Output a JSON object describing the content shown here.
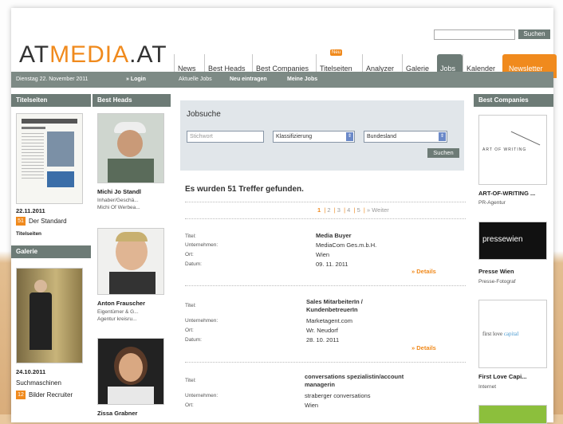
{
  "header": {
    "logo_a": "AT",
    "logo_m": "MEDIA",
    "logo_b": ".AT",
    "search_button": "Suchen"
  },
  "tabs": [
    {
      "label": "News"
    },
    {
      "label": "Best Heads"
    },
    {
      "label": "Best Companies"
    },
    {
      "label": "Titelseiten"
    },
    {
      "label": "Analyzer"
    },
    {
      "label": "Galerie"
    },
    {
      "label": "Jobs"
    },
    {
      "label": "Kalender"
    },
    {
      "label": "Newsletter"
    }
  ],
  "neu_badge": "Neu",
  "navbar": {
    "date": "Dienstag 22. November 2011",
    "login": "» Login",
    "links": [
      "Aktuelle Jobs",
      "Neu eintragen",
      "Meine Jobs"
    ]
  },
  "left": {
    "titelseiten_head": "Titelseiten",
    "ts_date": "22.11.2011",
    "ts_count": "51",
    "ts_paper": "Der Standard",
    "ts_link": "Titelseiten",
    "galerie_head": "Galerie",
    "gal_date": "24.10.2011",
    "gal_title": "Suchmaschinen",
    "gal_count": "12",
    "gal_label": "Bilder Recruiter"
  },
  "heads": {
    "head": "Best Heads",
    "people": [
      {
        "name": "Michi Jo Standl",
        "line1": "Inhaber/Geschä...",
        "line2": "Michi Of Werbea..."
      },
      {
        "name": "Anton Frauscher",
        "line1": "Eigentümer & G...",
        "line2": "Agentur kreisru..."
      },
      {
        "name": "Zissa Grabner",
        "line1": "",
        "line2": ""
      }
    ]
  },
  "jobsuche": {
    "title": "Jobsuche",
    "stichwort": "Stichwort",
    "klass": "Klassifizierung",
    "land": "Bundesland",
    "button": "Suchen",
    "result": "Es wurden 51 Treffer gefunden.",
    "pages": [
      "1",
      "2",
      "3",
      "4",
      "5"
    ],
    "weiter": "» Weiter"
  },
  "jobs": {
    "labels": {
      "titel": "Titel:",
      "unternehmen": "Unternehmen:",
      "ort": "Ort:",
      "datum": "Datum:"
    },
    "details": "» Details",
    "items": [
      {
        "titel": "Media Buyer",
        "titel2": "",
        "unternehmen": "MediaCom Ges.m.b.H.",
        "ort": "Wien",
        "datum": "09. 11. 2011"
      },
      {
        "titel": "Sales MitarbeiterIn /",
        "titel2": "KundenbetreuerIn",
        "unternehmen": "Marketagent.com",
        "ort": "Wr. Neudorf",
        "datum": "28. 10. 2011"
      },
      {
        "titel": "conversations spezialistin/account",
        "titel2": "managerin",
        "unternehmen": "straberger conversations",
        "ort": "Wien",
        "datum": ""
      }
    ]
  },
  "companies": {
    "head": "Best Companies",
    "items": [
      {
        "name": "ART-OF-WRITING ...",
        "type": "PR-Agentur",
        "logo": "ART OF WRITING"
      },
      {
        "name": "Presse Wien",
        "type": "Presse-Fotograf",
        "logo": "pressewien"
      },
      {
        "name": "First Love Capi...",
        "type": "Internet",
        "logo_a": "first love",
        "logo_b": "capital"
      }
    ]
  },
  "colors": {
    "accent": "#f08a1d",
    "nav": "#6d7b76",
    "box": "#e1e6ea"
  }
}
